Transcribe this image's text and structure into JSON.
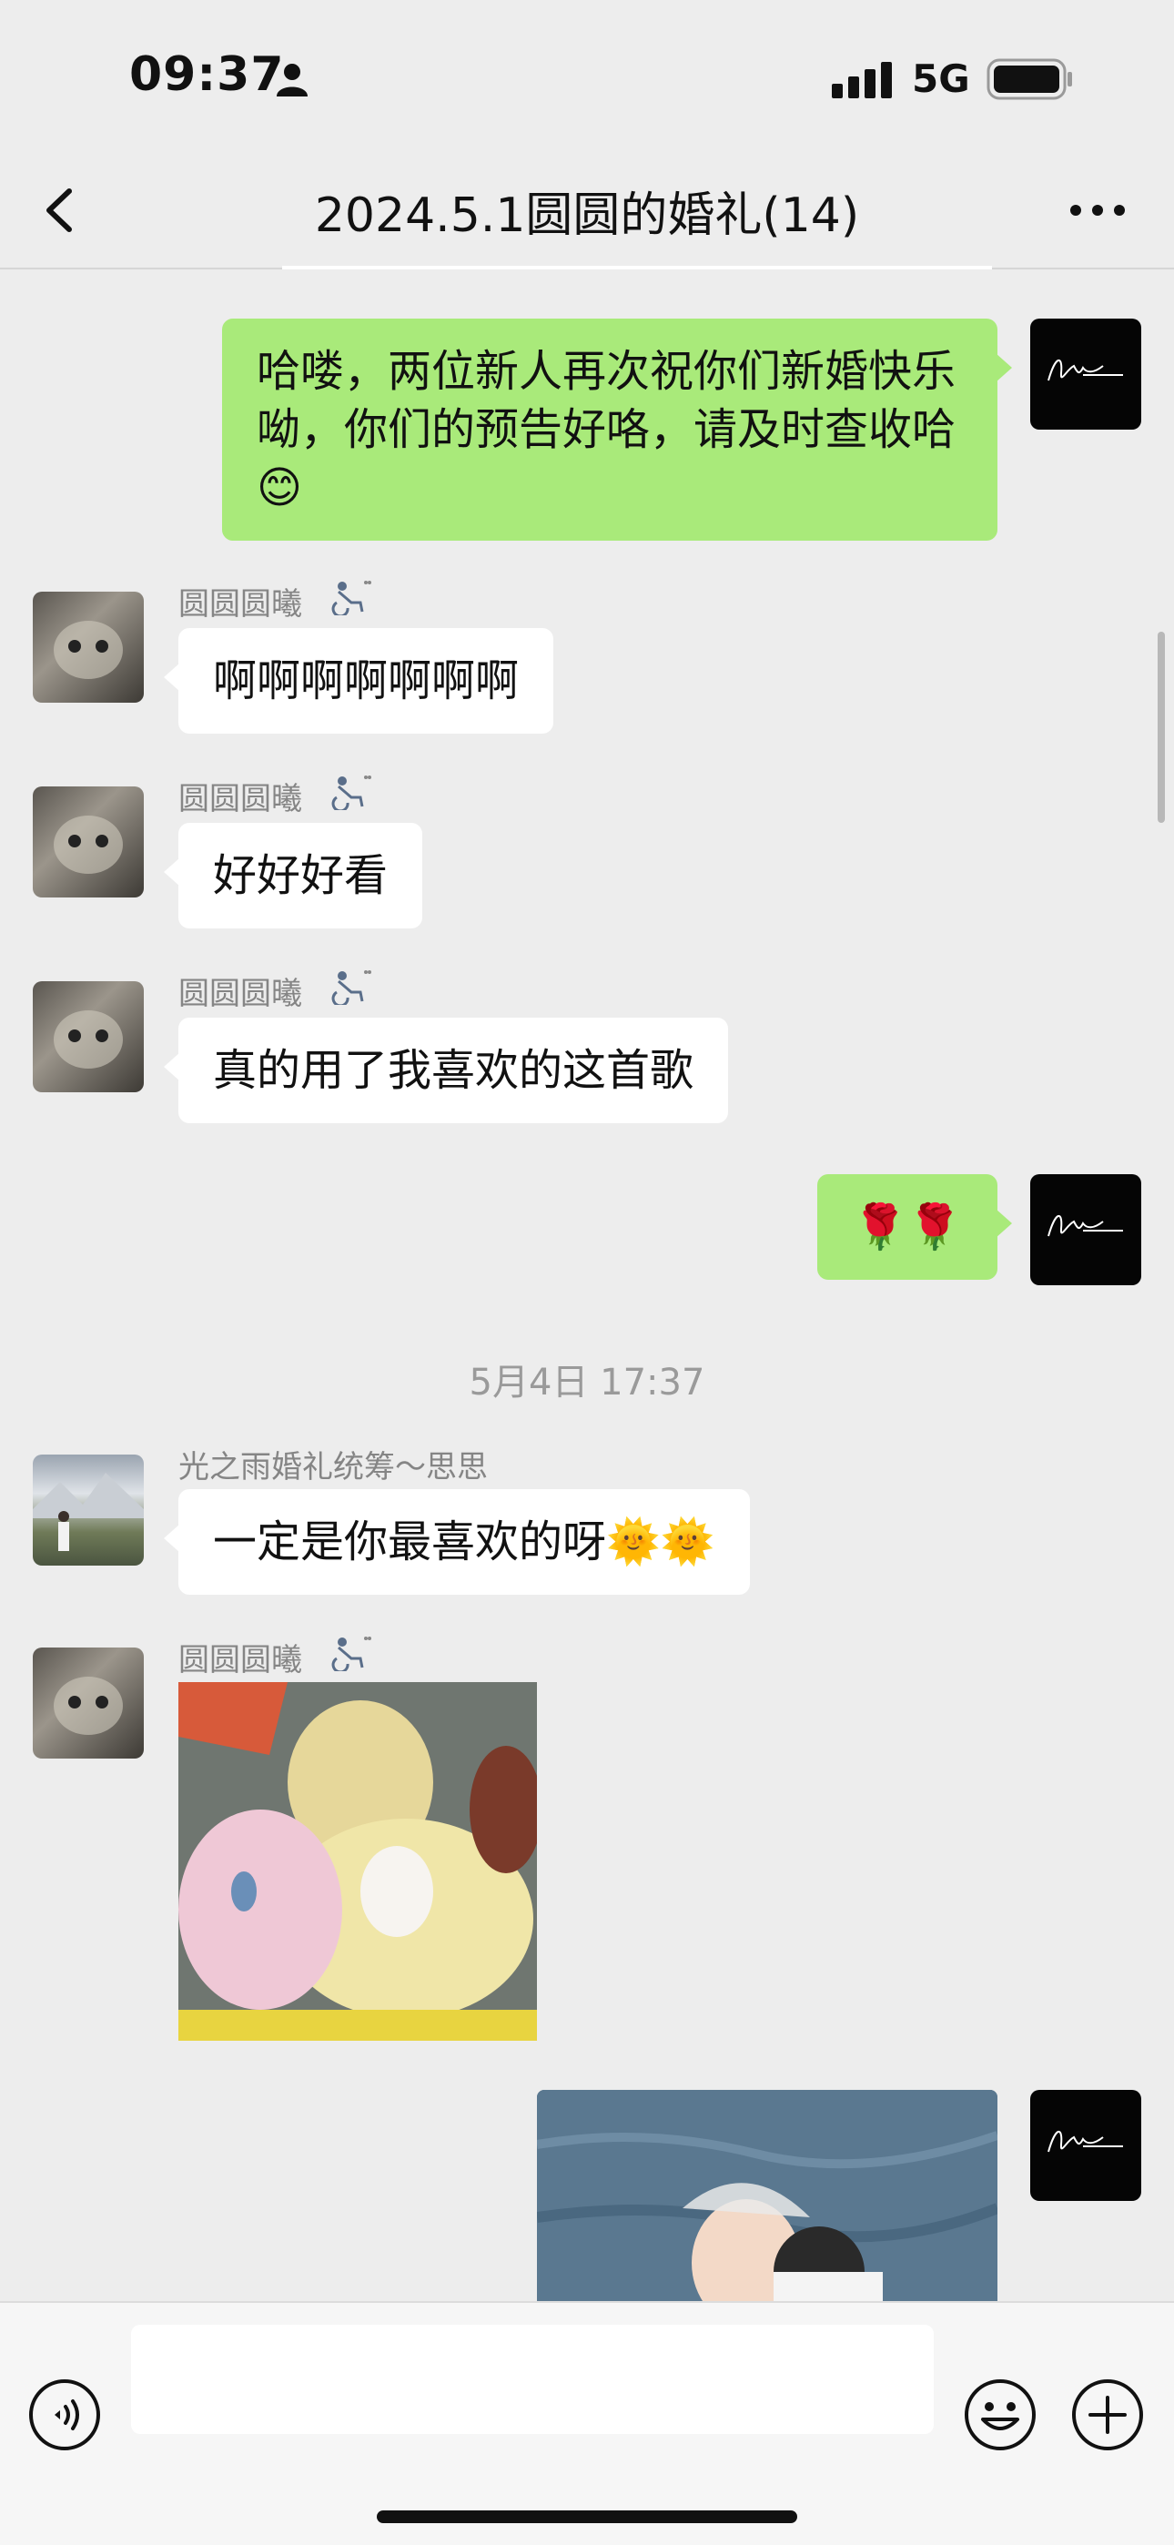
{
  "status_bar": {
    "time": "09:37",
    "network": "5G"
  },
  "nav": {
    "title": "2024.5.1圆圆的婚礼(14)"
  },
  "messages": [
    {
      "text": "哈喽，两位新人再次祝你们新婚快乐呦，你们的预告好咯，请及时查收哈😊"
    },
    {
      "sender": "圆圆圆曦",
      "text": "啊啊啊啊啊啊啊"
    },
    {
      "sender": "圆圆圆曦",
      "text": "好好好看"
    },
    {
      "sender": "圆圆圆曦",
      "text": "真的用了我喜欢的这首歌"
    },
    {
      "text": "🌹🌹"
    },
    {
      "sender": "光之雨婚礼统筹～思思",
      "text": "一定是你最喜欢的呀🌞🌞"
    },
    {
      "sender": "圆圆圆曦"
    }
  ],
  "timestamp": "5月4日 17:37",
  "input": {
    "placeholder": ""
  },
  "colors": {
    "outgoing_bubble": "#a9ea7a",
    "incoming_bubble": "#ffffff",
    "background": "#ededed"
  }
}
